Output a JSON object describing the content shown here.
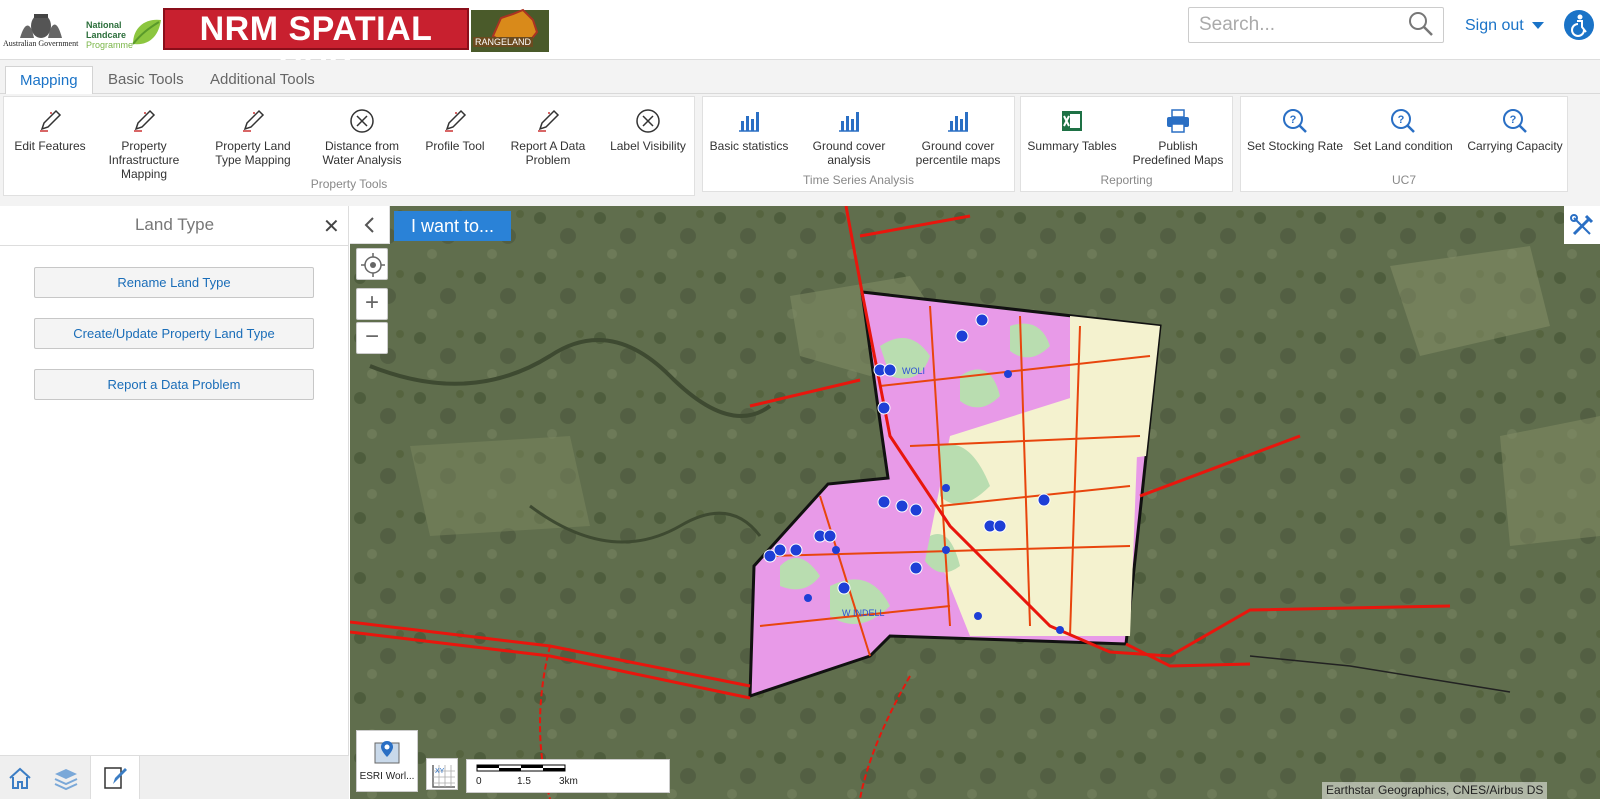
{
  "header": {
    "gov_text": "Australian Government",
    "landcare_line1": "National",
    "landcare_line2": "Landcare",
    "landcare_line3": "Programme",
    "brand_title": "NRM SPATIAL HUB",
    "rangeland_text": "RANGELAND",
    "search_placeholder": "Search...",
    "signout_label": "Sign out"
  },
  "tabs": [
    {
      "label": "Mapping",
      "active": true
    },
    {
      "label": "Basic Tools",
      "active": false
    },
    {
      "label": "Additional Tools",
      "active": false
    }
  ],
  "ribbon": {
    "groups": [
      {
        "label": "Property Tools",
        "tools": [
          {
            "label": "Edit Features",
            "icon": "pencil-edit-icon"
          },
          {
            "label": "Property Infrastructure Mapping",
            "icon": "pencil-edit-icon"
          },
          {
            "label": "Property Land Type Mapping",
            "icon": "pencil-edit-icon"
          },
          {
            "label": "Distance from Water Analysis",
            "icon": "circle-x-icon"
          },
          {
            "label": "Profile Tool",
            "icon": "pencil-edit-icon"
          },
          {
            "label": "Report A Data Problem",
            "icon": "pencil-edit-icon"
          },
          {
            "label": "Label Visibility",
            "icon": "circle-x-icon"
          }
        ]
      },
      {
        "label": "Time Series Analysis",
        "tools": [
          {
            "label": "Basic statistics",
            "icon": "bar-chart-icon"
          },
          {
            "label": "Ground cover analysis",
            "icon": "bar-chart-icon"
          },
          {
            "label": "Ground cover percentile maps",
            "icon": "bar-chart-icon"
          }
        ]
      },
      {
        "label": "Reporting",
        "tools": [
          {
            "label": "Summary Tables",
            "icon": "excel-icon"
          },
          {
            "label": "Publish Predefined Maps",
            "icon": "printer-icon"
          }
        ]
      },
      {
        "label": "UC7",
        "tools": [
          {
            "label": "Set Stocking Rate",
            "icon": "help-search-icon"
          },
          {
            "label": "Set Land condition",
            "icon": "help-search-icon"
          },
          {
            "label": "Carrying Capacity",
            "icon": "help-search-icon"
          }
        ]
      }
    ]
  },
  "panel": {
    "title": "Land Type",
    "close_glyph": "✕",
    "buttons": [
      "Rename Land Type",
      "Create/Update Property Land Type",
      "Report a Data Problem"
    ]
  },
  "map": {
    "i_want_to": "I want to...",
    "basemap_label": "ESRI Worl...",
    "xy_label": "XY",
    "scale_labels": [
      "0",
      "1.5",
      "3km"
    ],
    "attribution": "Earthstar Geographics, CNES/Airbus DS",
    "zoom_in": "+",
    "zoom_out": "−",
    "area_label_1": "WOLI",
    "area_label_2": "W INDELL"
  },
  "colors": {
    "accent": "#1a73c7",
    "brand_red": "#c8202f",
    "parcel_pink": "#e89ae8",
    "parcel_cream": "#f4f2cf",
    "parcel_green": "#b9ddb0",
    "infrastructure_red": "#e8160d"
  }
}
